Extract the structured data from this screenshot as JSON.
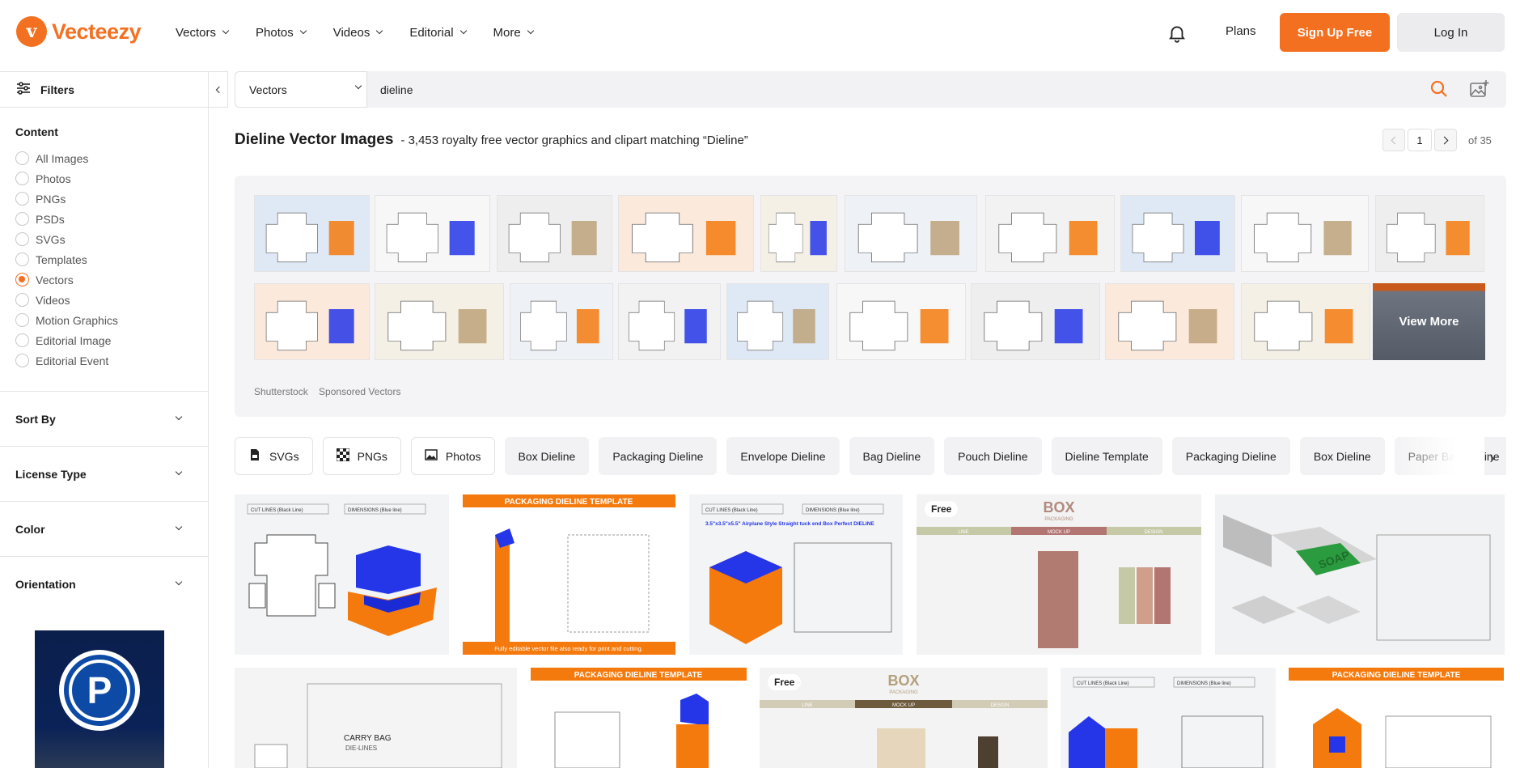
{
  "brand": {
    "name": "Vecteezy",
    "accent": "#f37021"
  },
  "nav": [
    {
      "label": "Vectors"
    },
    {
      "label": "Photos"
    },
    {
      "label": "Videos"
    },
    {
      "label": "Editorial"
    },
    {
      "label": "More"
    }
  ],
  "header": {
    "plans": "Plans",
    "signup": "Sign Up Free",
    "login": "Log In",
    "bell_icon": "bell-icon"
  },
  "sidebar": {
    "filters_label": "Filters",
    "content_title": "Content",
    "content_options": [
      {
        "label": "All Images",
        "selected": false
      },
      {
        "label": "Photos",
        "selected": false
      },
      {
        "label": "PNGs",
        "selected": false
      },
      {
        "label": "PSDs",
        "selected": false
      },
      {
        "label": "SVGs",
        "selected": false
      },
      {
        "label": "Templates",
        "selected": false
      },
      {
        "label": "Vectors",
        "selected": true
      },
      {
        "label": "Videos",
        "selected": false
      },
      {
        "label": "Motion Graphics",
        "selected": false
      },
      {
        "label": "Editorial Image",
        "selected": false
      },
      {
        "label": "Editorial Event",
        "selected": false
      }
    ],
    "accordions": [
      {
        "label": "Sort By"
      },
      {
        "label": "License Type"
      },
      {
        "label": "Color"
      },
      {
        "label": "Orientation"
      }
    ]
  },
  "search": {
    "category": "Vectors",
    "query": "dieline"
  },
  "results": {
    "title": "Dieline Vector Images",
    "subtitle": "- 3,453 royalty free vector graphics and clipart matching “Dieline”",
    "page": "1",
    "of_pages": "of 35"
  },
  "sponsored": {
    "view_more": "View More",
    "provider": "Shutterstock",
    "label": "Sponsored Vectors"
  },
  "chips": [
    {
      "label": "SVGs",
      "icon": "svg-file-icon",
      "kind": "type"
    },
    {
      "label": "PNGs",
      "icon": "png-checker-icon",
      "kind": "type"
    },
    {
      "label": "Photos",
      "icon": "photo-icon",
      "kind": "type"
    },
    {
      "label": "Box Dieline",
      "kind": "tag"
    },
    {
      "label": "Packaging Dieline",
      "kind": "tag"
    },
    {
      "label": "Envelope Dieline",
      "kind": "tag"
    },
    {
      "label": "Bag Dieline",
      "kind": "tag"
    },
    {
      "label": "Pouch Dieline",
      "kind": "tag"
    },
    {
      "label": "Dieline Template",
      "kind": "tag"
    },
    {
      "label": "Packaging Dieline",
      "kind": "tag"
    },
    {
      "label": "Box Dieline",
      "kind": "tag"
    },
    {
      "label": "Paper Bag Dieline",
      "kind": "tag"
    }
  ],
  "result_items": {
    "r1": {
      "h1": "CUT LINES (Black Line)",
      "h2": "DIMENSIONS (Blue line)"
    },
    "r2": {
      "banner": "PACKAGING DIELINE TEMPLATE",
      "footer": "Fully editable vector file also ready for print and cutting."
    },
    "r3": {
      "h1": "CUT LINES (Black Line)",
      "h2": "DIMENSIONS (Blue line)",
      "caption": "3.5\"x3.5\"x5.5\" Airplane Style Straight tuck end Box Perfect DIELINE"
    },
    "r4": {
      "badge": "Free",
      "title": "BOX",
      "sub": "PACKAGING",
      "cols": [
        "LINE",
        "MOCK UP",
        "DESIGN"
      ]
    },
    "r5": {
      "label": "SOAP"
    },
    "r6": {
      "title": "CARRY BAG",
      "sub": "DIE-LINES"
    },
    "r7": {
      "banner": "PACKAGING DIELINE TEMPLATE"
    },
    "r8": {
      "badge": "Free",
      "title": "BOX",
      "sub": "PACKAGING",
      "cols": [
        "LINE",
        "MOCK UP",
        "DESIGN"
      ]
    },
    "r9": {
      "h1": "CUT LINES (Black Line)",
      "h2": "DIMENSIONS (Blue line)"
    },
    "r10": {
      "banner": "PACKAGING DIELINE TEMPLATE"
    }
  }
}
